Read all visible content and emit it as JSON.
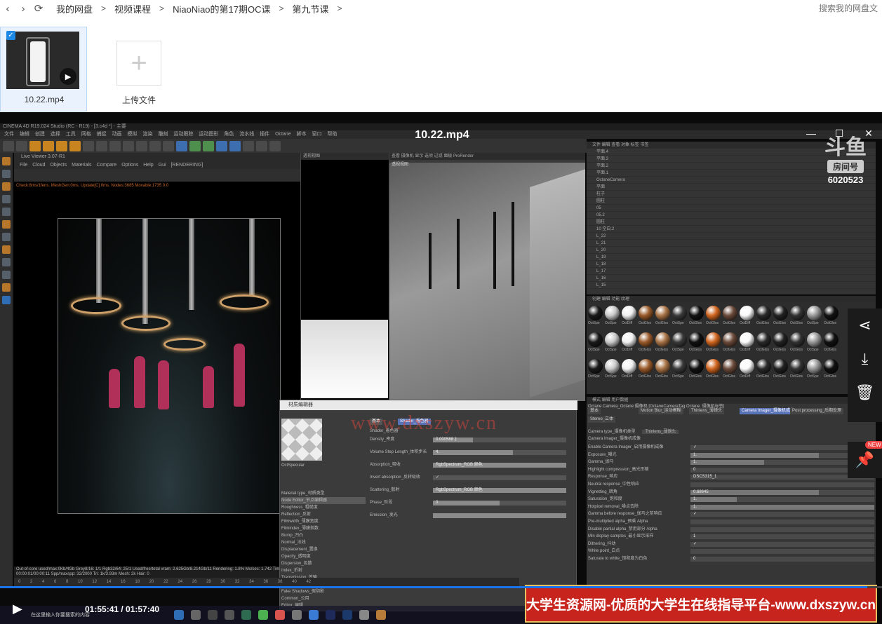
{
  "breadcrumb": {
    "items": [
      "我的网盘",
      "视频课程",
      "NiaoNiao的第17期OC课",
      "第九节课"
    ],
    "separator": ">"
  },
  "search": {
    "placeholder": "搜索我的网盘文"
  },
  "files": [
    {
      "name": "10.22.mp4",
      "selected": true
    }
  ],
  "upload": {
    "label": "上传文件",
    "icon": "plus-icon"
  },
  "player": {
    "title": "10.22.mp4",
    "current_time": "01:55:41",
    "total_time": "01:57:40",
    "time_display": "01:55:41 / 01:57:40",
    "progress_fraction": 0.983
  },
  "c4d": {
    "window_title": "CINEMA 4D R19.024 Studio (RC - R19) - [3.c4d *] - 主要",
    "menu": "文件 编辑 创建 选择 工具 网格 捕捉 动画 模拟 渲染 雕刻 运动跟踪 运动图形 角色 流水线 插件 Octane 脚本 窗口 帮助",
    "live_viewer_title": "Live Viewer 3.07-R1",
    "live_viewer_menu": "File Cloud Objects Materials Compare Options Help Gui [RENDERING]",
    "live_viewer_status": "Check:8ms/1fens. MeshGen:0ms. Update[C]:0ms. Nodes:3685 Movable:1735 0:0",
    "viewport_label": "透视视图",
    "viewport_label_2": "透视视图",
    "viewport_menu": "查看 摄像机 显示 选项 过滤 面板 ProRender",
    "viewer_footer": "Out-of-core used/max:0Kb/4Gb  Grey8/16: 1/1  Rgb32/64: 25/1  Used/free/total vram: 2.625Gb/8.214Gb/11  Rendering: 1.8%  Ms/sec: 1.742  Time: 00:00:01/00:00:11  Spp/maxspp: 32/2000  Tri: 1k/3.93m  Mesh: 2k  Hair: 0",
    "timeline_ticks": "0 2 4 6 8 10 12 14 16 18 20 22 24 26 28 30 32 34 36 38 40 42"
  },
  "material_editor": {
    "title": "材质编辑器",
    "name": "OctSpecular",
    "tabs": [
      "基本",
      "Shader_着色器"
    ],
    "shader_label": "Shader_着色器",
    "rows": [
      {
        "label": "Density_密度",
        "value": "0.000588 ‡",
        "fill": 0.3
      },
      {
        "label": "Volume Step Length_体积步长",
        "value": "4.",
        "fill": 0.6
      },
      {
        "label": "Absorption_吸收",
        "value": "RgbSpectrum_RGB 颜色",
        "fill": 1.0
      },
      {
        "label": "Invert absorption_反转吸收",
        "value": "✓",
        "fill": 0
      },
      {
        "label": "Scattering_散射",
        "value": "RgbSpectrum_RGB 颜色",
        "fill": 1.0
      },
      {
        "label": "Phase_阶段",
        "value": "0",
        "fill": 0.5
      },
      {
        "label": "Emission_发光",
        "value": "",
        "fill": 1.0
      }
    ],
    "list": [
      "Material type_材质类型",
      "Node Editor_节点编辑器",
      "Roughness_粗糙度",
      "Reflection_反射",
      "Filmwidth_薄膜宽度",
      "Filmindex_薄膜指数",
      "Bump_凹凸",
      "Normal_法线",
      "Displacement_置换",
      "Opacity_透明度",
      "Dispersion_色散",
      "Index_折射",
      "Transmission_传输",
      "Medium_媒介",
      "Fake Shadows_假阴影",
      "Common_公用",
      "Editor_编辑"
    ],
    "material_type_value": "Specular_镜面"
  },
  "object_manager": {
    "menu": "文件 编辑 查看 对象 标签 书签",
    "rows": [
      "平面.4",
      "平面.3",
      "平面.2",
      "平面.1",
      "OctaneCamera",
      "平面",
      "柱子",
      "圆柱",
      "05",
      "05.2",
      "圆柱",
      "10 空白.2",
      "L_22",
      "L_21",
      "L_20",
      "L_19",
      "L_18",
      "L_17",
      "L_16",
      "L_15"
    ]
  },
  "material_manager": {
    "menu": "创建 编辑 功能 纹理",
    "labels": [
      "OctSpe",
      "OctSpe",
      "OctDiff",
      "OctGlos",
      "OctGlos",
      "OctSpe",
      "OctGlos",
      "OctGlos",
      "OctGlos",
      "OctDiff",
      "OctGlos",
      "OctGlos",
      "OctGlos",
      "OctSpe",
      "OctGlos"
    ]
  },
  "attributes": {
    "menu": "模式 编辑 用户数据",
    "object": "Octane Camera_Octane 摄像机 [OctaneCameraTag.Octane_摄像机标签]",
    "tabs": [
      "基本",
      "Motion Blur_运动模糊",
      "Thinlens_薄镜头",
      "Camera Imager_摄像机成像",
      "Post processing_后期处理",
      "Stereo_立体"
    ],
    "camera_type_label": "Camera type_摄像机类型",
    "camera_type_value": "Thinlens_薄镜头",
    "section": "Camera Imager_摄像机成像",
    "rows": [
      {
        "label": "Enable Camera Imager_启用摄像机成像",
        "value": "✓",
        "fill": 0
      },
      {
        "label": "Exposure_曝光",
        "value": "1.",
        "fill": 0.7
      },
      {
        "label": "Gamma_伽马",
        "value": "1.",
        "fill": 0.4
      },
      {
        "label": "Highlight compression_高光压缩",
        "value": "0",
        "fill": 0
      },
      {
        "label": "Response_响应",
        "value": "DSCS315_1",
        "fill": 0
      },
      {
        "label": "Neutral response_中性响应",
        "value": "",
        "fill": 0
      },
      {
        "label": "Vignetting_暗角",
        "value": "0.68645",
        "fill": 0.7
      },
      {
        "label": "Saturation_饱和度",
        "value": "1.",
        "fill": 0.25
      },
      {
        "label": "Hotpixel removal_噪点去除",
        "value": "1.",
        "fill": 1.0
      },
      {
        "label": "Gamma before response_伽马之前响应",
        "value": "✓",
        "fill": 0
      },
      {
        "label": "Pre-multiplied alpha_预乘 Alpha",
        "value": "",
        "fill": 0
      },
      {
        "label": "Disable partial alpha_禁用部分 Alpha",
        "value": "",
        "fill": 0
      },
      {
        "label": "Min display samples_最小显示采样",
        "value": "1",
        "fill": 0
      },
      {
        "label": "Dithering_抖动",
        "value": "✓",
        "fill": 0
      },
      {
        "label": "White point_白点",
        "value": "",
        "fill": 0
      },
      {
        "label": "Saturate to white_饱和度为白色",
        "value": "0",
        "fill": 0
      }
    ]
  },
  "overlay": {
    "douyu_logo": "斗鱼",
    "douyu_room_label": "房间号",
    "douyu_room_number": "6020523",
    "watermark": "www.dxszyw.cn",
    "banner": "大学生资源网-优质的大学生在线指导平台-www.dxszyw.cn",
    "new_badge": "NEW",
    "taskbar_search": "在这里输入你要搜索的内容"
  },
  "colors": {
    "accent": "#1a73e8",
    "banner_red": "#c8241e",
    "selection_bg": "#e9f2fd"
  }
}
